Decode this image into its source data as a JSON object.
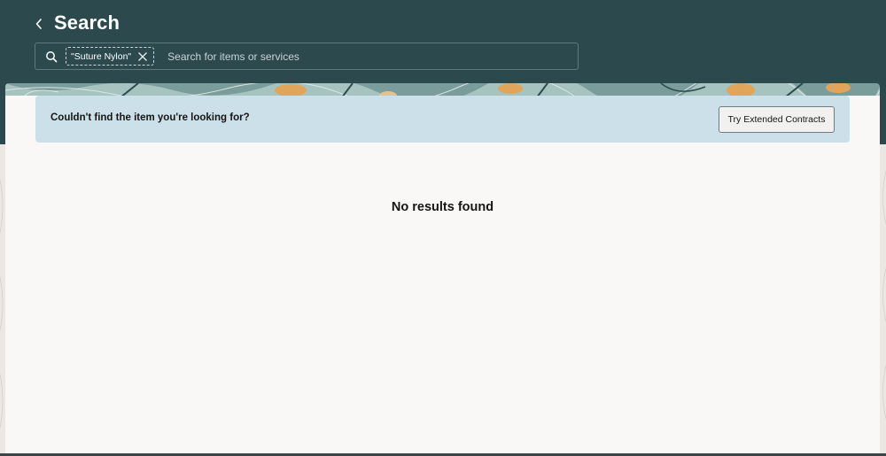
{
  "header": {
    "title": "Search",
    "back_icon": "chevron-left-icon"
  },
  "search": {
    "chip_label": "\"Suture Nylon\"",
    "placeholder": "Search for items or services",
    "value": "",
    "icon": "search-icon"
  },
  "notice": {
    "text": "Couldn't find the item you're looking for?",
    "button_label": "Try Extended Contracts"
  },
  "results": {
    "empty_message": "No results found"
  },
  "colors": {
    "header_bg": "#2c4a4e",
    "notice_bg": "#cce0ea",
    "card_bg": "#f9f8f6",
    "accent_orange": "#e0a55a",
    "accent_teal": "#8fb3b2"
  }
}
